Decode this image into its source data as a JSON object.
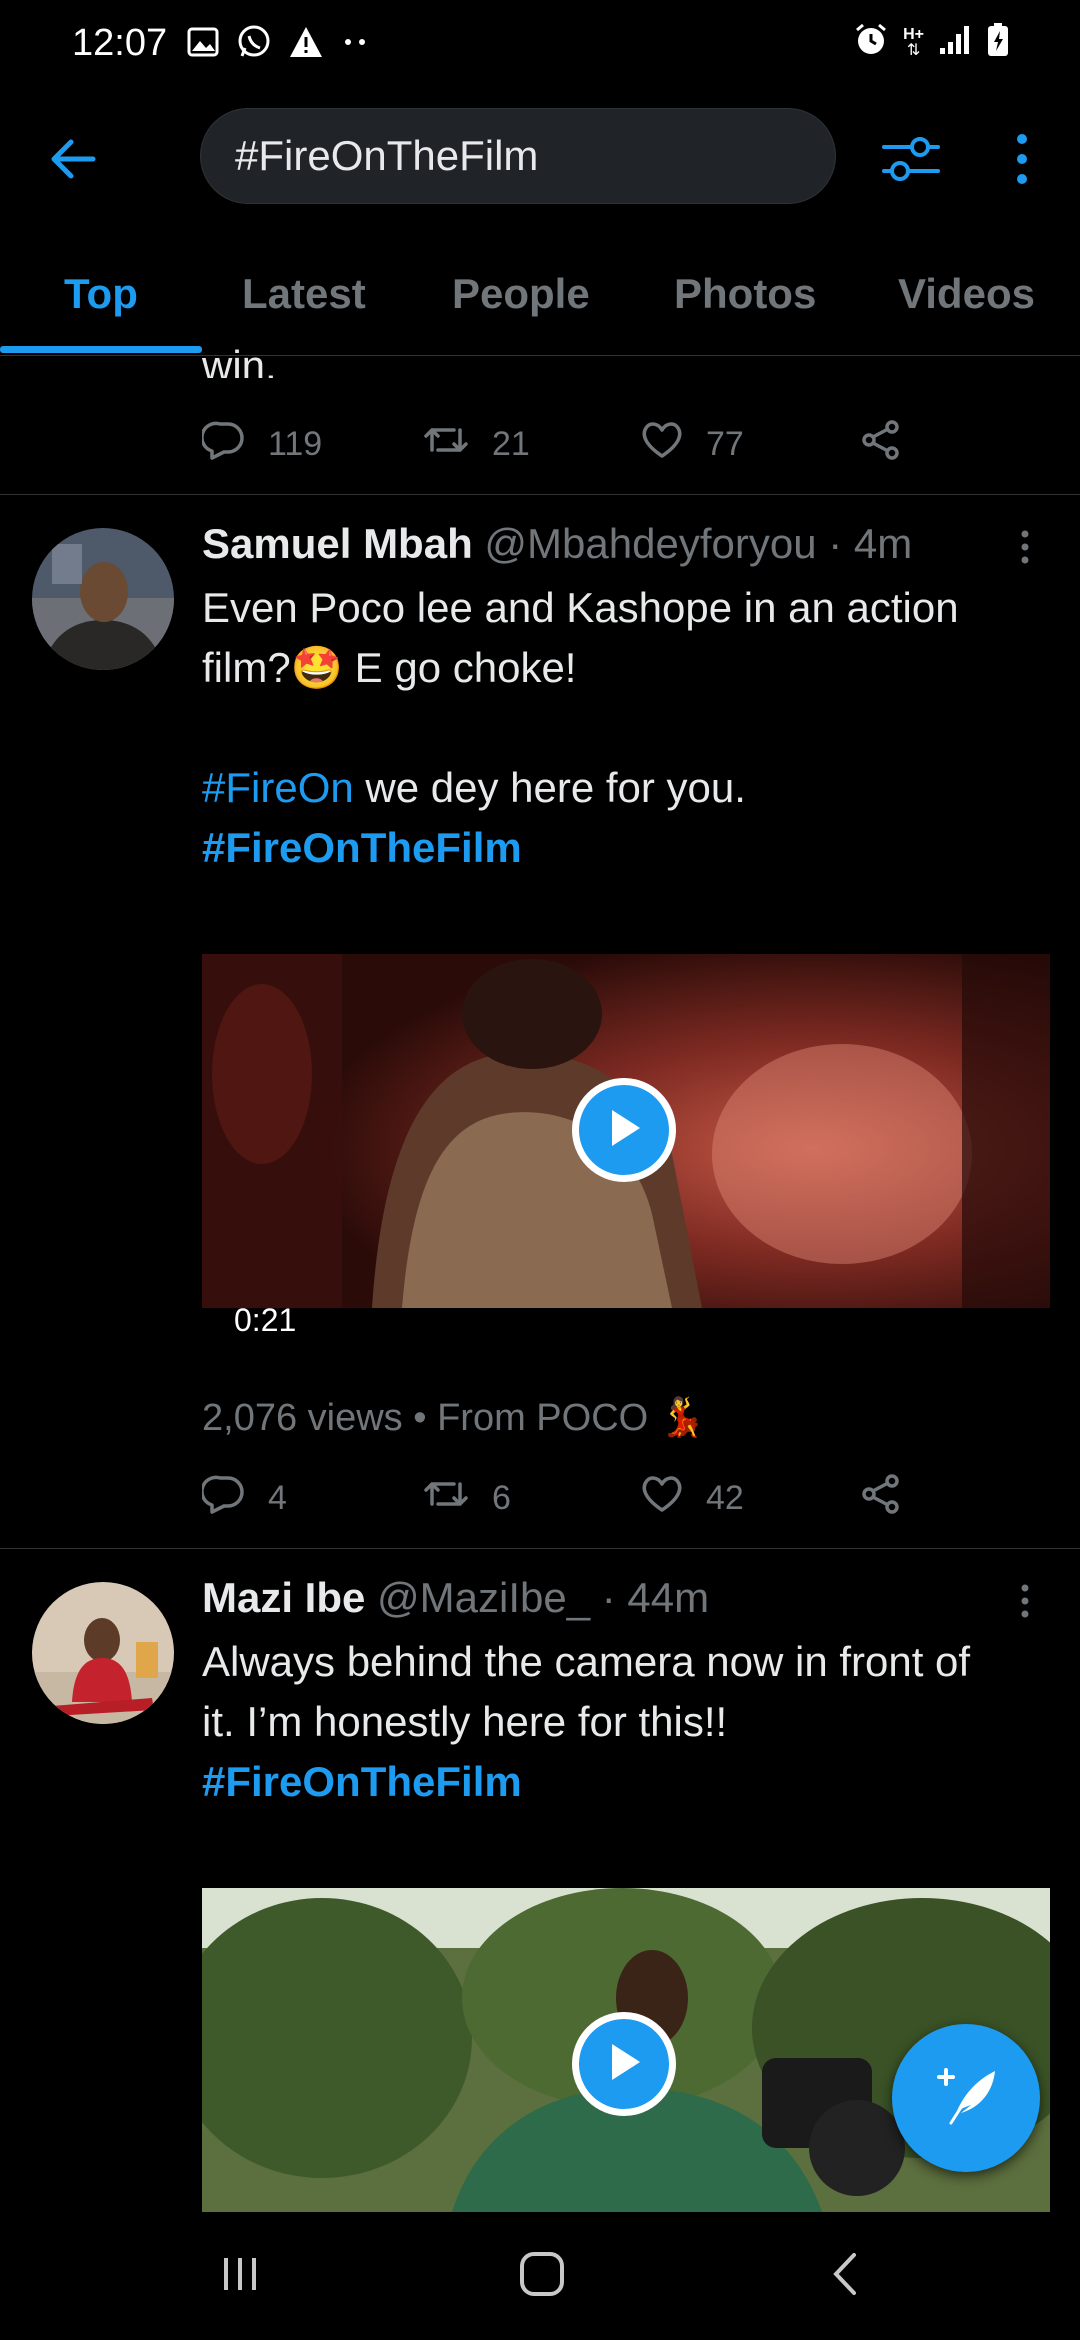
{
  "status_bar": {
    "time": "12:07",
    "left_icons": [
      "gallery-icon",
      "whatsapp-icon",
      "warning-icon",
      "more-dots-icon"
    ],
    "right_icons": [
      "alarm-icon",
      "network-type-icon",
      "signal-icon",
      "battery-icon"
    ],
    "network_label": "H+"
  },
  "app_bar": {
    "search_query": "#FireOnTheFilm"
  },
  "tabs": [
    {
      "label": "Top",
      "active": true
    },
    {
      "label": "Latest",
      "active": false
    },
    {
      "label": "People",
      "active": false
    },
    {
      "label": "Photos",
      "active": false
    },
    {
      "label": "Videos",
      "active": false
    }
  ],
  "previous_tweet": {
    "text_tail": "win.",
    "replies": "119",
    "retweets": "21",
    "likes": "77"
  },
  "tweets": [
    {
      "name": "Samuel Mbah",
      "handle": "@Mbahdeyforyou",
      "time": "· 4m",
      "text_line1": "Even Poco lee and Kashope in an action",
      "text_line2_a": "film?",
      "emoji": "🤩",
      "text_line2_b": " E go choke!",
      "hashtag1": "#FireOn",
      "text_line4_rest": " we dey here for you.",
      "hashtag2": "#FireOnTheFilm",
      "video_duration": "0:21",
      "views_text": "2,076 views • From POCO ",
      "views_emoji": "💃",
      "replies": "4",
      "retweets": "6",
      "likes": "42"
    },
    {
      "name": "Mazi Ibe",
      "handle": "@MaziIbe_",
      "time": "· 44m",
      "text_line1": "Always behind the camera now in front of",
      "text_line2": "it. I’m honestly here for this!!",
      "hashtag": "#FireOnTheFilm"
    }
  ],
  "colors": {
    "accent": "#1d9bf0",
    "background": "#000000",
    "secondary_text": "#71767b",
    "primary_text": "#e7e9ea",
    "divider": "#2f3336"
  }
}
